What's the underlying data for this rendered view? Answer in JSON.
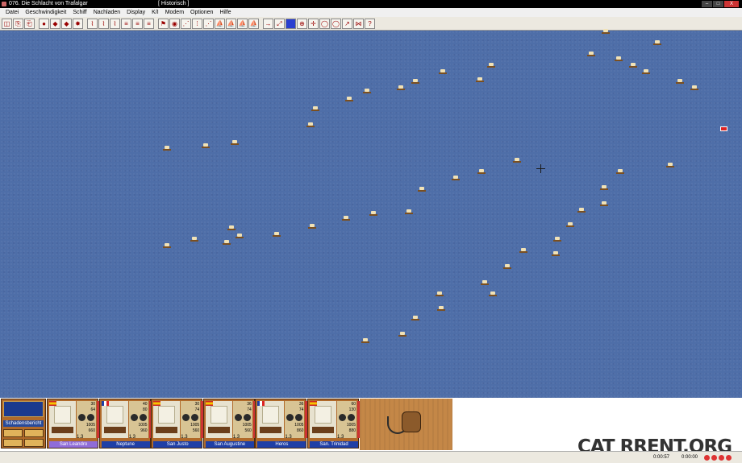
{
  "window": {
    "title": "076. Die Schlacht von Trafalgar",
    "subtitle": "[ Historisch ]",
    "controls": [
      "–",
      "□",
      "X"
    ]
  },
  "menu": [
    "Datei",
    "Geschwindigkeit",
    "Schiff",
    "Nachladen",
    "Display",
    "K/I",
    "Modem",
    "Optionen",
    "Hilfe"
  ],
  "toolbar_icons": [
    "new-icon",
    "copy-icon",
    "paste-icon",
    "stop-icon",
    "fire-icon",
    "fire2-icon",
    "fire3-icon",
    "reload-a-icon",
    "reload-b-icon",
    "reload-c-icon",
    "sail-a-icon",
    "sail-b-icon",
    "sail-c-icon",
    "flag-icon",
    "compass-icon",
    "formation-a-icon",
    "formation-b-icon",
    "formation-c-icon",
    "ship-a-icon",
    "ship-b-icon",
    "ship-c-icon",
    "ship-d-icon",
    "arrow-icon",
    "select-icon",
    "select-blue-icon",
    "move-icon",
    "target-icon",
    "bulb-a-icon",
    "bulb-b-icon",
    "curve-icon",
    "swap-icon",
    "help-icon"
  ],
  "toolbar_glyphs": [
    "◫",
    "⎘",
    "⎗",
    "●",
    "◆",
    "◆",
    "✸",
    "⌇",
    "⌇",
    "⌇",
    "≡",
    "≡",
    "≡",
    "⚑",
    "◉",
    "⋰",
    "⁞",
    "⋰",
    "⛵",
    "⛵",
    "⛵",
    "⛵",
    "→",
    "⤢",
    "■",
    "⊕",
    "✛",
    "◯",
    "◯",
    "↗",
    "⋈",
    "?"
  ],
  "command_panel": {
    "damage_report": "Schadensbericht"
  },
  "ships": [
    {
      "name": "San Leandro",
      "nation": "spain",
      "stats": [
        "30",
        "64",
        "1005",
        "660"
      ],
      "ratio": "1.3",
      "selected": true
    },
    {
      "name": "Neptune",
      "nation": "france",
      "stats": [
        "40",
        "80",
        "1005",
        "960"
      ],
      "ratio": "1.3",
      "selected": false
    },
    {
      "name": "San Justo",
      "nation": "spain",
      "stats": [
        "30",
        "74",
        "1005",
        "560"
      ],
      "ratio": "1.3",
      "selected": false
    },
    {
      "name": "San Augustine",
      "nation": "spain",
      "stats": [
        "36",
        "74",
        "1005",
        "560"
      ],
      "ratio": "1.3",
      "selected": false
    },
    {
      "name": "Heros",
      "nation": "france",
      "stats": [
        "36",
        "74",
        "1005",
        "860"
      ],
      "ratio": "1.3",
      "selected": false
    },
    {
      "name": "San. Trinidad",
      "nation": "spain",
      "stats": [
        "60",
        "130",
        "1005",
        "880"
      ],
      "ratio": "1.3",
      "selected": false
    }
  ],
  "watermark": "CAT RRENT.ORG",
  "status": {
    "time_elapsed": "0:00:57",
    "time_remaining": "0:00:00"
  },
  "colors": {
    "sea": "#4e6ea8",
    "panel_wood": "#b06a2a",
    "name_plate": "#1f3fa6",
    "name_plate_selected": "#8f6cd8"
  }
}
